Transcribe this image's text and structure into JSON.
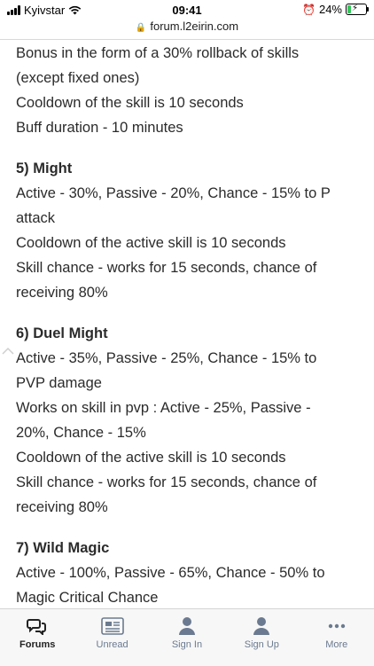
{
  "status": {
    "carrier": "Kyivstar",
    "time": "09:41",
    "battery": "24%",
    "battery_level": 0.24
  },
  "browser": {
    "url": "forum.l2eirin.com"
  },
  "content": {
    "intro_lines": [
      "Bonus in the form of a 30% rollback of skills",
      "(except fixed ones)",
      "Cooldown of the skill is 10 seconds",
      "Buff duration - 10 minutes"
    ],
    "sections": [
      {
        "title": "5) Might",
        "lines": [
          "Active - 30%, Passive - 20%, Chance - 15% to P",
          "attack",
          "Cooldown of the active skill is 10 seconds",
          "Skill chance - works for 15 seconds, chance of",
          "receiving 80%"
        ]
      },
      {
        "title": "6) Duel Might",
        "lines": [
          "Active - 35%, Passive - 25%, Chance - 15% to",
          "PVP damage",
          "Works on skill in pvp : Active - 25%, Passive -",
          "20%, Chance - 15%",
          "Cooldown of the active skill is 10 seconds",
          "Skill chance - works for 15 seconds, chance of",
          "receiving 80%"
        ]
      },
      {
        "title": "7) Wild Magic",
        "lines": [
          "Active - 100%, Passive - 65%, Chance - 50% to",
          "Magic Critical Chance"
        ]
      }
    ]
  },
  "tabbar": {
    "items": [
      {
        "label": "Forums",
        "icon": "forums-icon",
        "active": true
      },
      {
        "label": "Unread",
        "icon": "newspaper-icon",
        "active": false
      },
      {
        "label": "Sign In",
        "icon": "user-icon",
        "active": false
      },
      {
        "label": "Sign Up",
        "icon": "user-add-icon",
        "active": false
      },
      {
        "label": "More",
        "icon": "more-icon",
        "active": false
      }
    ]
  },
  "colors": {
    "tab_inactive": "#6b7a90",
    "tab_active": "#222222",
    "battery_fill": "#34c759"
  }
}
